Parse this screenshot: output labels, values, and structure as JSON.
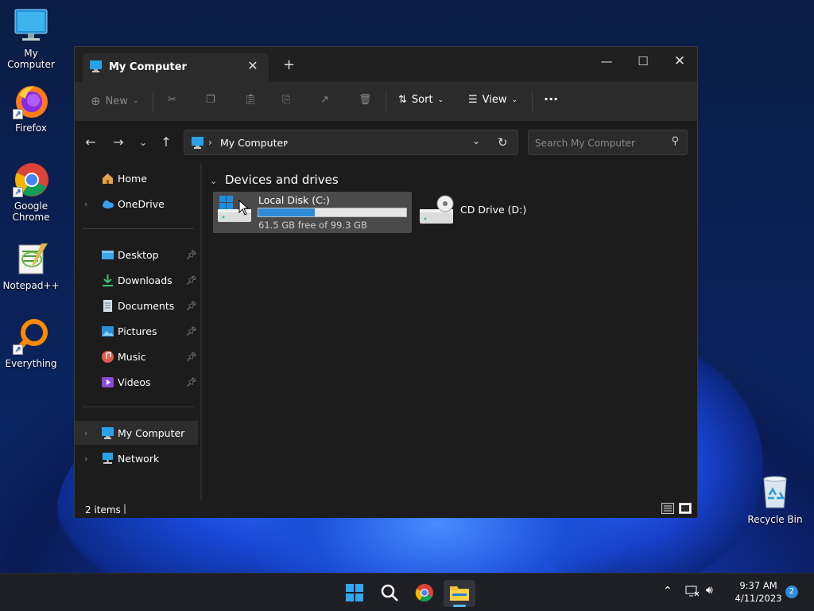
{
  "desktop": {
    "icons": [
      {
        "label": "My Computer",
        "icon": "monitor-icon"
      },
      {
        "label": "Firefox",
        "icon": "firefox-icon"
      },
      {
        "label": "Google Chrome",
        "icon": "chrome-icon"
      },
      {
        "label": "Notepad++",
        "icon": "notepad-plus-plus-icon"
      },
      {
        "label": "Everything",
        "icon": "search-magnifier-icon"
      },
      {
        "label": "Recycle Bin",
        "icon": "recycle-bin-icon"
      }
    ]
  },
  "window": {
    "tab_title": "My Computer",
    "toolbar": {
      "new_label": "New",
      "sort_label": "Sort",
      "view_label": "View",
      "more_label": "···"
    },
    "address": {
      "path_label": "My Computer",
      "separator": "›"
    },
    "search": {
      "placeholder": "Search My Computer"
    },
    "sidebar": {
      "items": [
        {
          "label": "Home",
          "icon": "home-icon"
        },
        {
          "label": "OneDrive",
          "icon": "cloud-icon"
        },
        {
          "label": "Desktop",
          "icon": "desktop-folder-icon"
        },
        {
          "label": "Downloads",
          "icon": "download-icon"
        },
        {
          "label": "Documents",
          "icon": "document-icon"
        },
        {
          "label": "Pictures",
          "icon": "picture-icon"
        },
        {
          "label": "Music",
          "icon": "music-icon"
        },
        {
          "label": "Videos",
          "icon": "video-icon"
        },
        {
          "label": "My Computer",
          "icon": "monitor-icon"
        },
        {
          "label": "Network",
          "icon": "network-icon"
        }
      ]
    },
    "main": {
      "section_title": "Devices and drives",
      "drives": [
        {
          "label": "Local Disk (C:)",
          "detail": "61.5 GB free of 99.3 GB",
          "used_fraction": 0.38,
          "icon": "hard-drive-icon"
        },
        {
          "label": "CD Drive (D:)",
          "icon": "cd-drive-icon"
        }
      ]
    },
    "status": {
      "items_count": "2 items"
    }
  },
  "taskbar": {
    "time": "9:37 AM",
    "date": "4/11/2023",
    "notification_count": "2",
    "apps": [
      "start-icon",
      "search-icon",
      "chrome-icon",
      "file-explorer-icon"
    ]
  },
  "colors": {
    "accent": "#2f8bd8",
    "window_bg": "#1c1c1c",
    "taskbar_bg": "#1e1f24"
  }
}
